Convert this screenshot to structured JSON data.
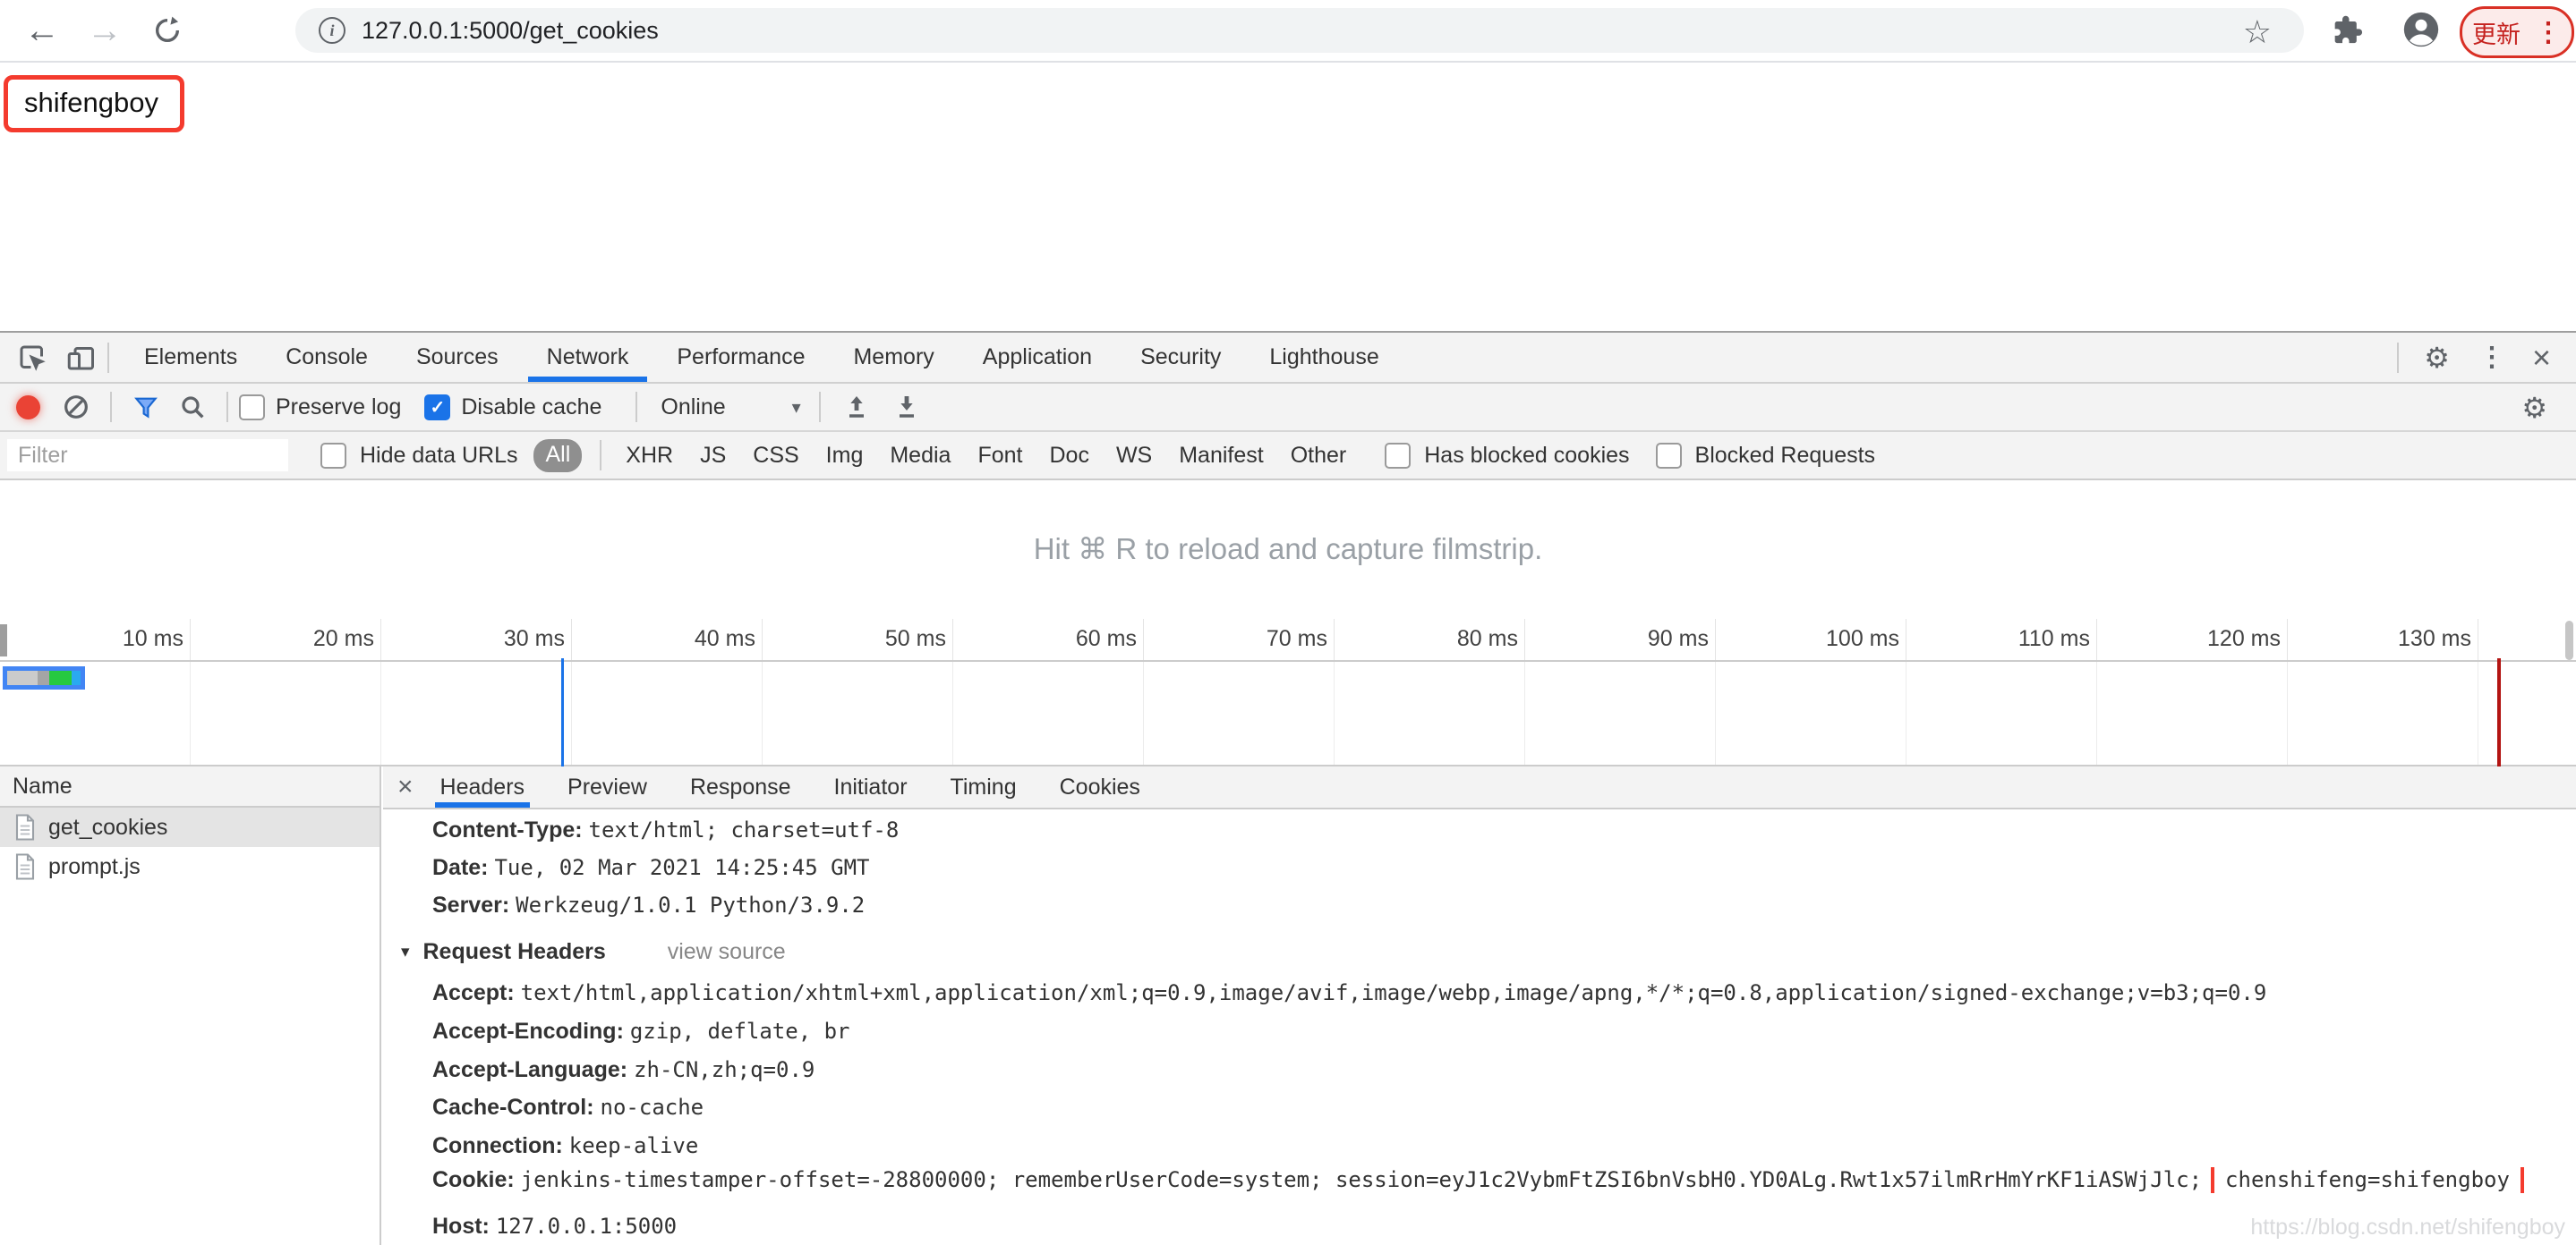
{
  "browser": {
    "url": "127.0.0.1:5000/get_cookies",
    "update_button": "更新"
  },
  "icons": {
    "back": "←",
    "forward": "→",
    "star": "☆",
    "menu_dots": "⋮",
    "close": "×",
    "gear": "⚙",
    "dropdown": "▾",
    "disclosure": "▾",
    "check": "✓",
    "info": "i"
  },
  "page": {
    "highlighted_text": "shifengboy"
  },
  "watermark": "https://blog.csdn.net/shifengboy",
  "colors": {
    "accent_blue": "#1a73e8",
    "record_red": "#ea4335",
    "annotation_red": "#f43b2e",
    "update_red": "#c5221f",
    "waterfall_green": "#26c940",
    "waterfall_blue": "#2aa9f0",
    "event_line_red": "#b31412"
  },
  "devtools": {
    "tabs": [
      "Elements",
      "Console",
      "Sources",
      "Network",
      "Performance",
      "Memory",
      "Application",
      "Security",
      "Lighthouse"
    ],
    "active_tab": "Network",
    "toolbar": {
      "preserve_log": "Preserve log",
      "disable_cache": "Disable cache",
      "throttling": "Online"
    },
    "filter_bar": {
      "placeholder": "Filter",
      "hide_data_urls": "Hide data URLs",
      "types": [
        "All",
        "XHR",
        "JS",
        "CSS",
        "Img",
        "Media",
        "Font",
        "Doc",
        "WS",
        "Manifest",
        "Other"
      ],
      "has_blocked_cookies": "Has blocked cookies",
      "blocked_requests": "Blocked Requests"
    },
    "filmstrip_hint": "Hit ⌘ R to reload and capture filmstrip.",
    "timeline": {
      "labels": [
        "10 ms",
        "20 ms",
        "30 ms",
        "40 ms",
        "50 ms",
        "60 ms",
        "70 ms",
        "80 ms",
        "90 ms",
        "100 ms",
        "110 ms",
        "120 ms",
        "130 ms"
      ]
    },
    "requests": {
      "header": "Name",
      "rows": [
        {
          "name": "get_cookies"
        },
        {
          "name": "prompt.js"
        }
      ]
    },
    "details": {
      "tabs": [
        "Headers",
        "Preview",
        "Response",
        "Initiator",
        "Timing",
        "Cookies"
      ],
      "active_tab": "Headers",
      "response_headers": [
        {
          "name": "Content-Type:",
          "value": "text/html; charset=utf-8"
        },
        {
          "name": "Date:",
          "value": "Tue, 02 Mar 2021 14:25:45 GMT"
        },
        {
          "name": "Server:",
          "value": "Werkzeug/1.0.1 Python/3.9.2"
        }
      ],
      "request_headers_title": "Request Headers",
      "view_source": "view source",
      "request_headers": [
        {
          "name": "Accept:",
          "value": "text/html,application/xhtml+xml,application/xml;q=0.9,image/avif,image/webp,image/apng,*/*;q=0.8,application/signed-exchange;v=b3;q=0.9"
        },
        {
          "name": "Accept-Encoding:",
          "value": "gzip, deflate, br"
        },
        {
          "name": "Accept-Language:",
          "value": "zh-CN,zh;q=0.9"
        },
        {
          "name": "Cache-Control:",
          "value": "no-cache"
        },
        {
          "name": "Connection:",
          "value": "keep-alive"
        }
      ],
      "cookie": {
        "name": "Cookie:",
        "value_prefix": "jenkins-timestamper-offset=-28800000; rememberUserCode=system; session=eyJ1c2VybmFtZSI6bnVsbH0.YD0ALg.Rwt1x57ilmRrHmYrKF1iASWjJlc;",
        "value_highlight": "chenshifeng=shifengboy"
      },
      "host": {
        "name": "Host:",
        "value": "127.0.0.1:5000"
      }
    }
  }
}
